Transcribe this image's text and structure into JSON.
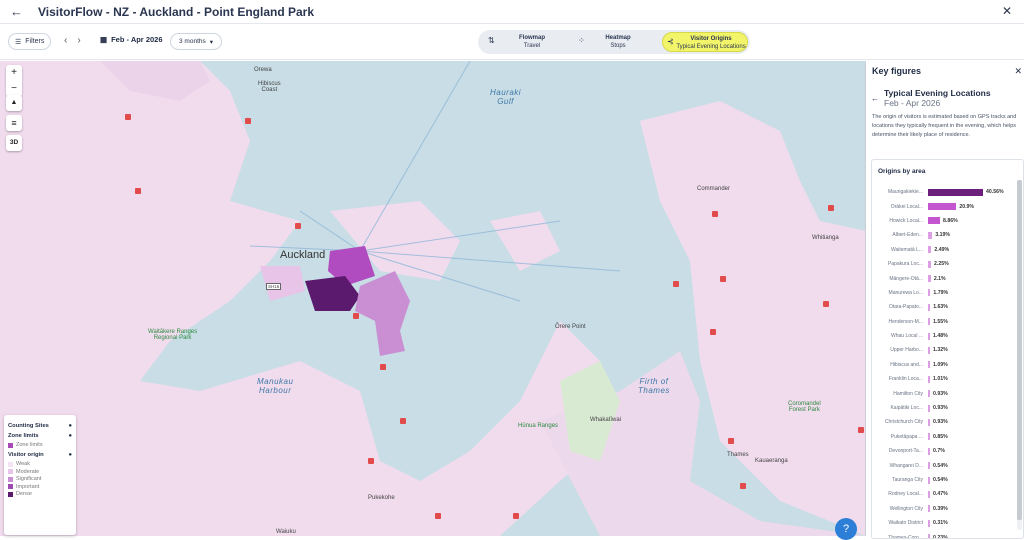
{
  "header": {
    "title": "VisitorFlow - NZ - Auckland - Point England Park"
  },
  "toolbar": {
    "filters_label": "Filters",
    "date_range": "Feb - Apr 2026",
    "period": "3 months",
    "modes": [
      {
        "title": "Flowmap",
        "sub": "Travel"
      },
      {
        "title": "Heatmap",
        "sub": "Stops"
      },
      {
        "title": "Visitor Origins",
        "sub": "Typical Evening Locations"
      }
    ]
  },
  "map": {
    "controls": {
      "zoom_in": "+",
      "zoom_out": "−",
      "compass": "▲",
      "mode3d": "3D"
    },
    "labels": {
      "orewa": "Orewa",
      "hibiscus": "Hibiscus\nCoast",
      "hauraki": "Hauraki\nGulf",
      "auckland": "Auckland",
      "waitakere": "Waitākere Ranges\nRegional Park",
      "manukau": "Manukau\nHarbour",
      "orere": "Ōrere Point",
      "firth": "Firth of\nThames",
      "commander": "Commander",
      "whitianga": "Whitianga",
      "coromandel": "Coromandel\nForest Park",
      "hunua": "Hūnua Ranges",
      "whakatiwai": "Whakatīwai",
      "thames": "Thames",
      "kauaeranga": "Kauaeranga",
      "pukekohe": "Pukekohe",
      "waiuku": "Waiuku",
      "bridge": "SH16"
    }
  },
  "legend": {
    "counting_sites": "Counting Sites",
    "zone_limits": "Zone limits",
    "zone_limits_item": "Zone limits",
    "visitor_origin": "Visitor origin",
    "levels": [
      {
        "label": "Weak",
        "color": "#f3e3f3"
      },
      {
        "label": "Moderate",
        "color": "#e7c4e8"
      },
      {
        "label": "Significant",
        "color": "#c98fd2"
      },
      {
        "label": "Important",
        "color": "#9c4ab0"
      },
      {
        "label": "Dense",
        "color": "#5b1a6e"
      }
    ]
  },
  "panel": {
    "title": "Key figures",
    "sub_title": "Typical Evening Locations",
    "sub_date": "Feb - Apr 2026",
    "description": "The origin of visitors is estimated based on GPS tracks and locations they typically frequent in the evening, which helps determine their likely place of residence.",
    "card_title": "Origins by area",
    "origins": [
      {
        "name": "Maungakiekie...",
        "value": 40.56,
        "label": "40.56%"
      },
      {
        "name": "Ōrākei Local...",
        "value": 20.9,
        "label": "20.9%"
      },
      {
        "name": "Howick Local...",
        "value": 8.86,
        "label": "8.86%"
      },
      {
        "name": "Albert-Eden...",
        "value": 3.19,
        "label": "3.19%"
      },
      {
        "name": "Waitematā L...",
        "value": 2.49,
        "label": "2.49%"
      },
      {
        "name": "Papakura Loc...",
        "value": 2.25,
        "label": "2.25%"
      },
      {
        "name": "Māngere-Ōtā...",
        "value": 2.1,
        "label": "2.1%"
      },
      {
        "name": "Manurewa Lo...",
        "value": 1.79,
        "label": "1.79%"
      },
      {
        "name": "Ōtara-Papato...",
        "value": 1.63,
        "label": "1.63%"
      },
      {
        "name": "Henderson-M...",
        "value": 1.55,
        "label": "1.55%"
      },
      {
        "name": "Whau Local ...",
        "value": 1.48,
        "label": "1.48%"
      },
      {
        "name": "Upper Harbo...",
        "value": 1.32,
        "label": "1.32%"
      },
      {
        "name": "Hibiscus and...",
        "value": 1.09,
        "label": "1.09%"
      },
      {
        "name": "Franklin Loca...",
        "value": 1.01,
        "label": "1.01%"
      },
      {
        "name": "Hamilton City",
        "value": 0.93,
        "label": "0.93%"
      },
      {
        "name": "Kaipātiki Loc...",
        "value": 0.93,
        "label": "0.93%"
      },
      {
        "name": "Christchurch City",
        "value": 0.93,
        "label": "0.93%"
      },
      {
        "name": "Puketāpapa ...",
        "value": 0.85,
        "label": "0.85%"
      },
      {
        "name": "Devonport-Ta...",
        "value": 0.7,
        "label": "0.7%"
      },
      {
        "name": "Whangarei D...",
        "value": 0.54,
        "label": "0.54%"
      },
      {
        "name": "Tauranga City",
        "value": 0.54,
        "label": "0.54%"
      },
      {
        "name": "Rodney Local...",
        "value": 0.47,
        "label": "0.47%"
      },
      {
        "name": "Wellington City",
        "value": 0.39,
        "label": "0.39%"
      },
      {
        "name": "Waikato District",
        "value": 0.31,
        "label": "0.31%"
      },
      {
        "name": "Thames-Coro...",
        "value": 0.23,
        "label": "0.23%"
      }
    ]
  },
  "colors": {
    "bar_dense": "#6b1f7a",
    "bar_mid": "#c456cf",
    "bar_light": "#dd9ee3",
    "active_mode": "#f2f56a",
    "help": "#2d7ed6"
  }
}
